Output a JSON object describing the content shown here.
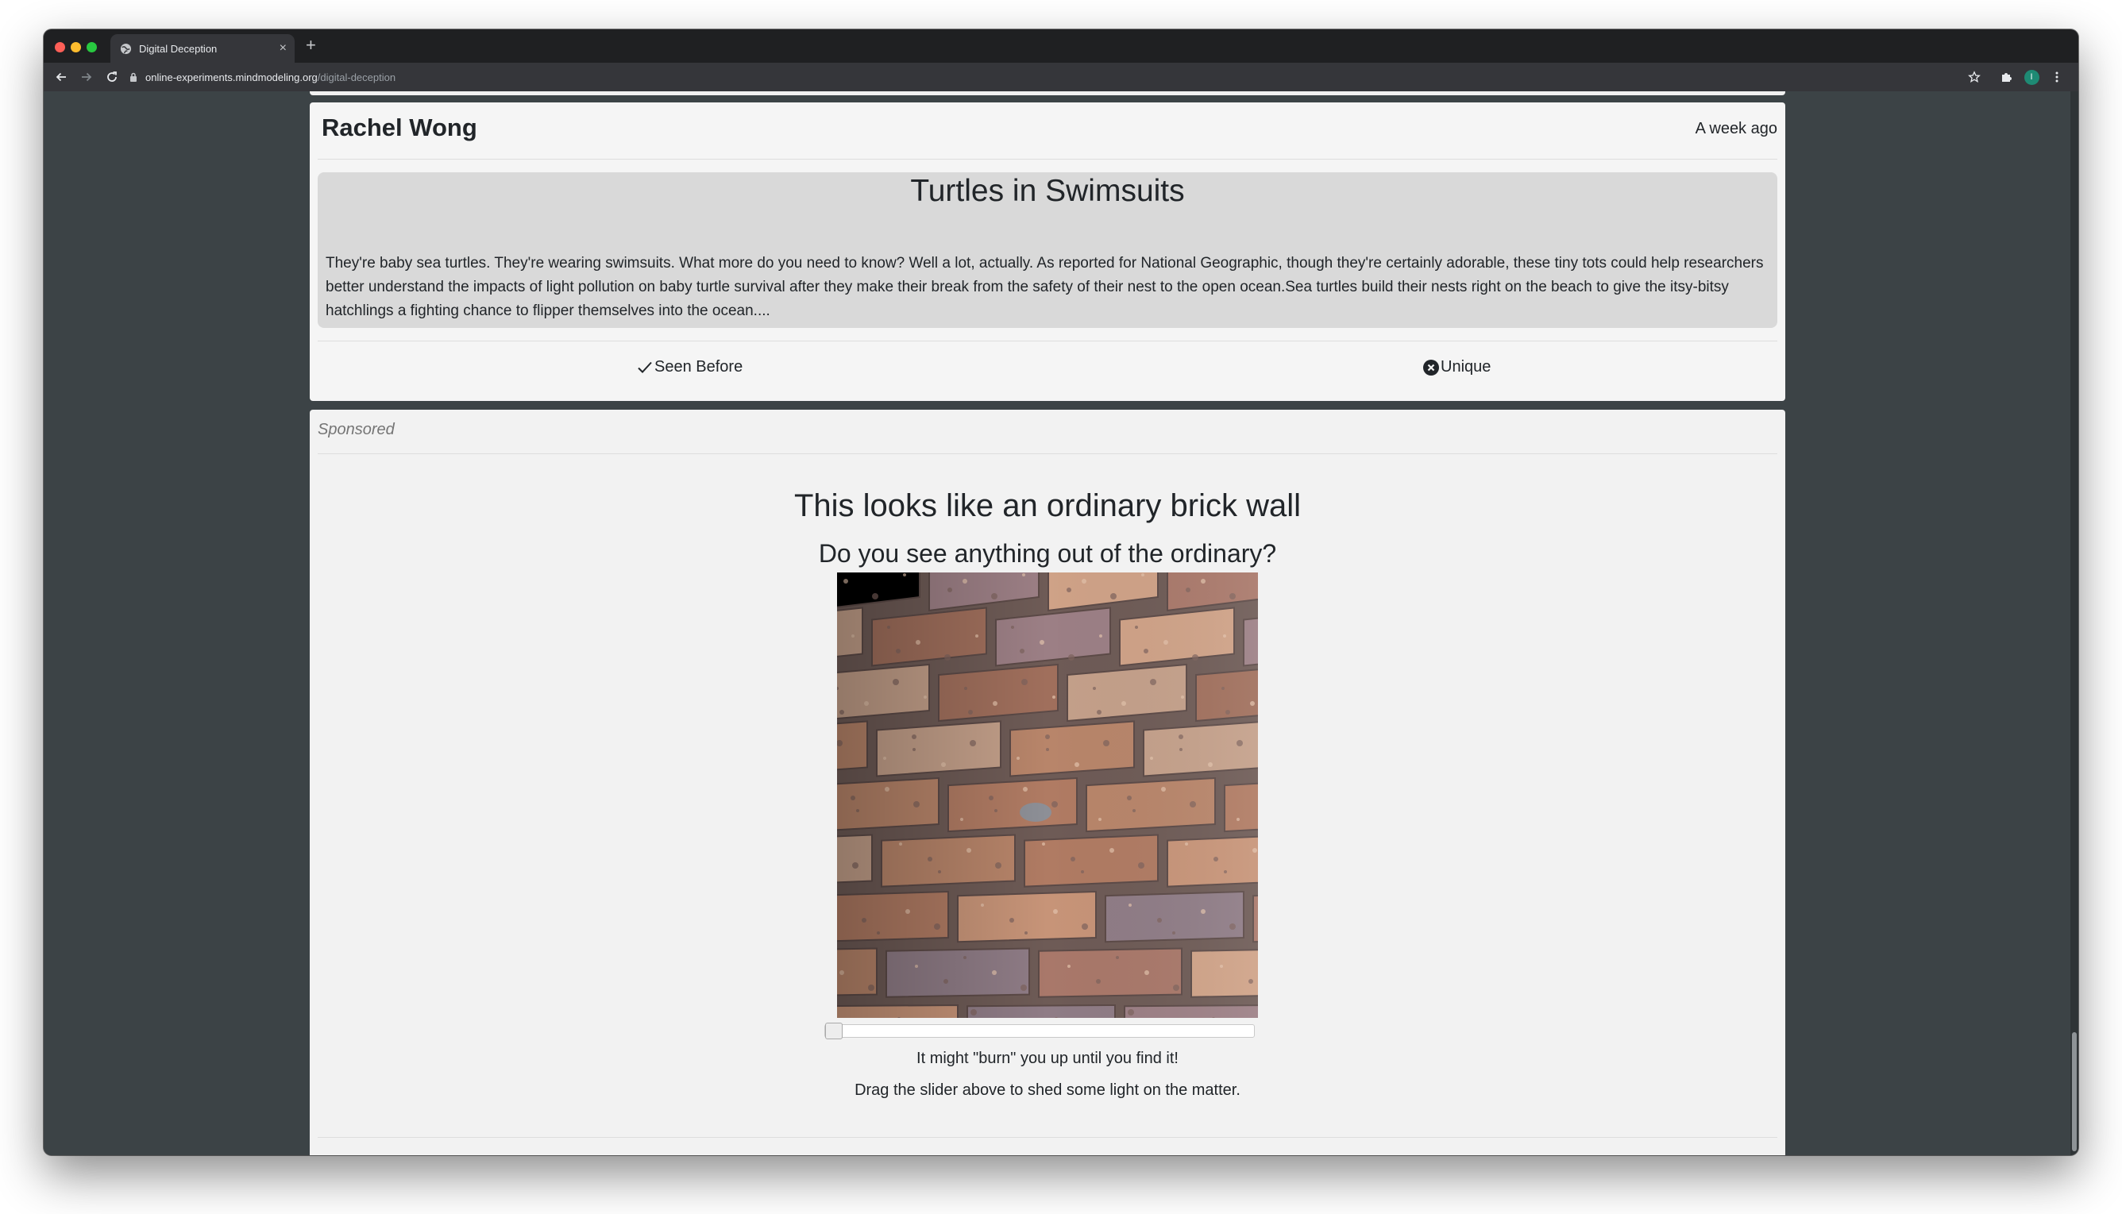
{
  "browser": {
    "tab_title": "Digital Deception",
    "url_host": "online-experiments.mindmodeling.org",
    "url_path": "/digital-deception",
    "profile_initial": "I"
  },
  "post": {
    "author": "Rachel Wong",
    "timestamp": "A week ago",
    "title": "Turtles in Swimsuits",
    "body": "They're baby sea turtles. They're wearing swimsuits. What more do you need to know? Well a lot, actually. As reported for National Geographic, though they're certainly adorable, these tiny tots could help researchers better understand the impacts of light pollution on baby turtle survival after they make their break from the safety of their nest to the open ocean.Sea turtles build their nests right on the beach to give the itsy-bitsy hatchlings a fighting chance to flipper themselves into the ocean....",
    "actions": {
      "seen_before": "Seen Before",
      "unique": "Unique"
    }
  },
  "ad": {
    "label": "Sponsored",
    "title": "This looks like an ordinary brick wall",
    "subtitle": "Do you see anything out of the ordinary?",
    "slider_value": 0,
    "hint_line1": "It might \"burn\" you up until you find it!",
    "hint_line2": "Drag the slider above to shed some light on the matter."
  },
  "colors": {
    "page_background": "#3c4346",
    "card_background": "#f5f5f5",
    "article_background": "#d9d9d9",
    "text": "#212529"
  }
}
